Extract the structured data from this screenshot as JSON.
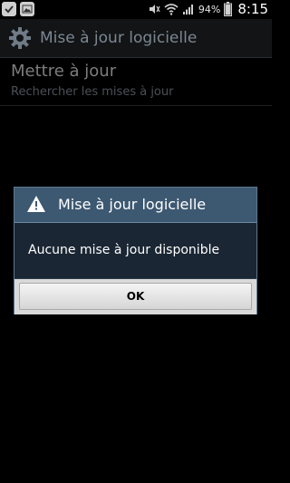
{
  "status_bar": {
    "battery_percent": "94%",
    "time": "8:15",
    "icons": [
      "check-icon",
      "image-icon",
      "mute-icon",
      "wifi-icon",
      "signal-icon",
      "battery-icon"
    ]
  },
  "action_bar": {
    "title": "Mise à jour logicielle",
    "icon": "gear-icon"
  },
  "list": {
    "items": [
      {
        "title": "Mettre à jour",
        "subtitle": "Rechercher les mises à jour"
      }
    ]
  },
  "dialog": {
    "title": "Mise à jour logicielle",
    "icon": "warning-icon",
    "message": "Aucune mise à jour disponible",
    "ok_label": "OK"
  }
}
